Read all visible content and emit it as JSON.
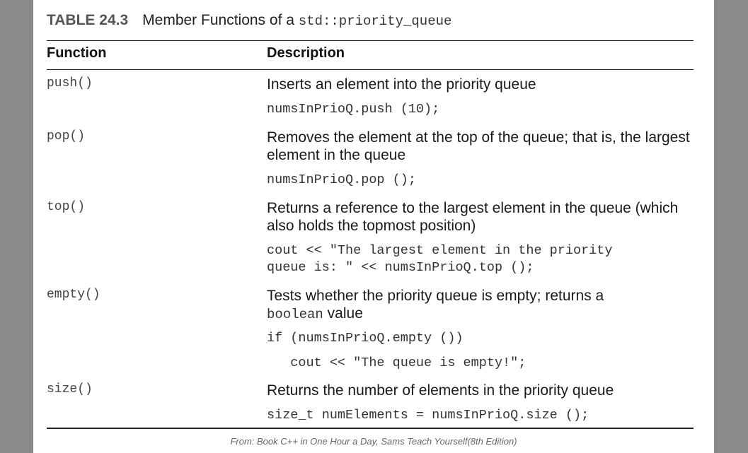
{
  "table": {
    "number": "TABLE 24.3",
    "title_text": "Member Functions of a",
    "title_code": "std::priority_queue"
  },
  "headers": {
    "function": "Function",
    "description": "Description"
  },
  "rows": [
    {
      "function": "push()",
      "description": "Inserts an element into the priority queue",
      "code": "numsInPrioQ.push (10);"
    },
    {
      "function": "pop()",
      "description": "Removes the element at the top of the queue; that is, the largest element in the queue",
      "code": "numsInPrioQ.pop ();"
    },
    {
      "function": "top()",
      "description": "Returns a reference to the largest element in the queue (which also holds the topmost position)",
      "code": "cout << \"The largest element in the priority\nqueue is: \" << numsInPrioQ.top ();"
    },
    {
      "function": "empty()",
      "description_before": "Tests whether the priority queue is empty; returns a",
      "description_code": "boolean",
      "description_after": "value",
      "code": "if (numsInPrioQ.empty ())",
      "code_2": "   cout << \"The queue is empty!\";"
    },
    {
      "function": "size()",
      "description": "Returns the number of elements in the priority queue",
      "code": "size_t numElements = numsInPrioQ.size ();"
    }
  ],
  "caption": "From: Book C++ in One Hour a Day, Sams Teach Yourself(8th Edition)"
}
